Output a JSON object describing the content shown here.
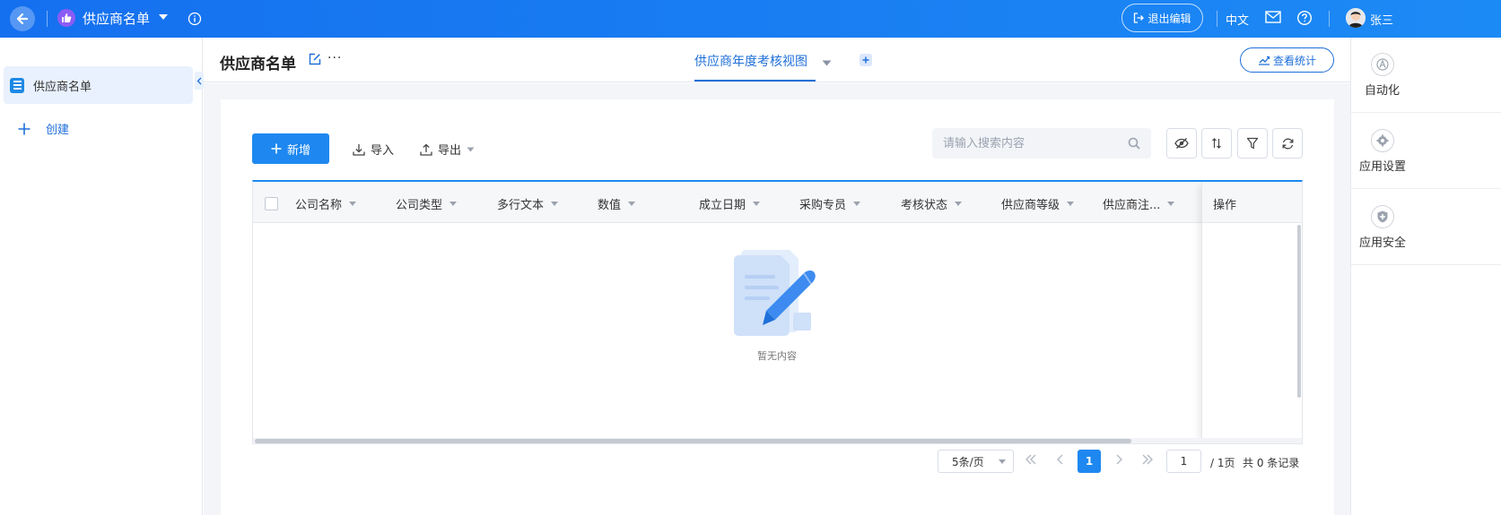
{
  "topbar": {
    "app_title": "供应商名单",
    "exit_edit_label": "退出编辑",
    "language": "中文",
    "user_name": "张三"
  },
  "sidebar": {
    "items": [
      {
        "label": "供应商名单",
        "icon": "form-doc-icon"
      }
    ],
    "create_label": "创建"
  },
  "header": {
    "page_title": "供应商名单",
    "more_label": "···",
    "active_view": "供应商年度考核视图",
    "stats_label": "查看统计"
  },
  "toolbar": {
    "new_label": "新增",
    "import_label": "导入",
    "export_label": "导出",
    "search_placeholder": "请输入搜索内容"
  },
  "table": {
    "columns": [
      "公司名称",
      "公司类型",
      "多行文本",
      "数值",
      "成立日期",
      "采购专员",
      "考核状态",
      "供应商等级",
      "供应商注..."
    ],
    "ops_column": "操作",
    "rows": [],
    "empty_text": "暂无内容"
  },
  "pagination": {
    "page_size": "5条/页",
    "current_page": "1",
    "page_input": "1",
    "total_pages": "/ 1页",
    "total_records": "共 0 条记录"
  },
  "right_panel": {
    "items": [
      {
        "label": "自动化",
        "icon": "automation-icon"
      },
      {
        "label": "应用设置",
        "icon": "settings-icon"
      },
      {
        "label": "应用安全",
        "icon": "security-icon"
      }
    ]
  },
  "colors": {
    "topbar": "#1570ef",
    "accent": "#1e88f0",
    "link": "#1e6fd9",
    "app_icon": "#8b5cf6"
  }
}
